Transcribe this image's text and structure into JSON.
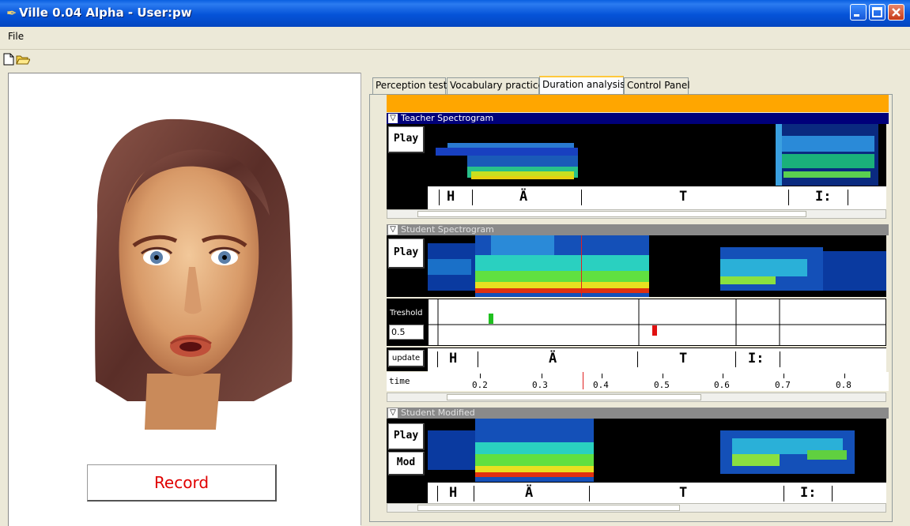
{
  "window": {
    "title": "Ville 0.04 Alpha - User:pw"
  },
  "menu": {
    "file": "File"
  },
  "toolbar": {
    "new_icon": "new-document-icon",
    "open_icon": "open-folder-icon"
  },
  "left": {
    "record_label": "Record"
  },
  "tabs": [
    {
      "label": "Perception test"
    },
    {
      "label": "Vocabulary practice"
    },
    {
      "label": "Duration analysis",
      "active": true
    },
    {
      "label": "Control Panel"
    }
  ],
  "teacher": {
    "header": "Teacher Spectrogram",
    "play": "Play",
    "segments": [
      "H",
      "Ä",
      "T",
      "I:"
    ]
  },
  "student": {
    "header": "Student Spectrogram",
    "play": "Play",
    "threshold_label": "Treshold",
    "threshold_value": "0.5",
    "update": "update",
    "segments": [
      "H",
      "Ä",
      "T",
      "I:"
    ],
    "time_label": "time",
    "time_ticks": [
      "0.2",
      "0.3",
      "0.4",
      "0.5",
      "0.6",
      "0.7",
      "0.8"
    ]
  },
  "modified": {
    "header": "Student Modified",
    "play": "Play",
    "mod": "Mod",
    "segments": [
      "H",
      "Ä",
      "T",
      "I:"
    ]
  },
  "colors": {
    "accent_orange": "#ffa600",
    "teacher_header": "#00007a",
    "record_text": "#e00000"
  }
}
